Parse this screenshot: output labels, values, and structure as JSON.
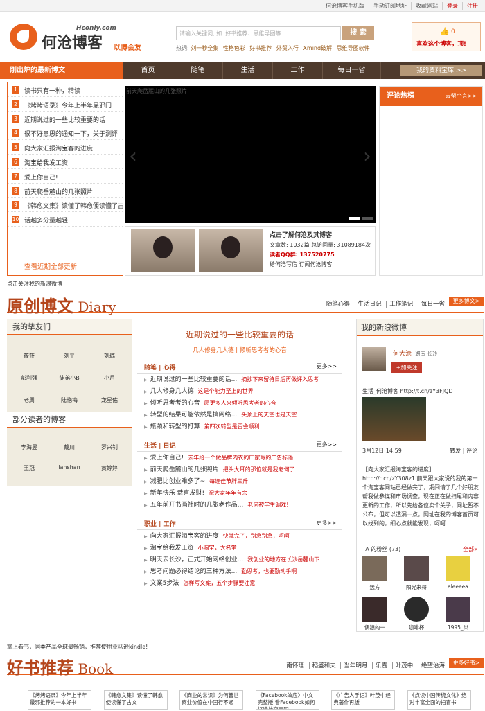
{
  "topbar": {
    "links": [
      "何沧博客手机版",
      "手动订阅地址",
      "收藏网站"
    ],
    "login": "登录",
    "register": "注册"
  },
  "logo": {
    "domain": "Hconly.com",
    "name": "何沧博客",
    "tagline": "以博会友"
  },
  "search": {
    "placeholder": "请输入关键词, 如: 好书推荐、思维导图等...",
    "button": "搜 索"
  },
  "hot": {
    "label": "热词:",
    "words": [
      "刘一秒全集",
      "性格色彩",
      "好书推荐",
      "外贸入行",
      "Xmind破解",
      "思维导图软件"
    ]
  },
  "like": {
    "count": "0",
    "text": "喜欢这个博客，顶!"
  },
  "nav": {
    "latest": "刚出炉的最新博文",
    "items": [
      "首页",
      "随笔",
      "生活",
      "工作",
      "每日一省"
    ],
    "library": "我的资料宝库 >>"
  },
  "latest": {
    "items": [
      "读书只有一种，精读",
      "《烤烤语录》今年上半年最邪门",
      "近期说过的一些比较重要的话",
      "很不好意思的通知一下，关于测评",
      "向大家汇报淘宝客的进度",
      "淘宝给我发工资",
      "爱上你自己!",
      "前天爬岳麓山的几张照片",
      "《韩愈文集》读懂了韩愈便读懂了古文",
      "话越多分量越轻"
    ],
    "more": "查看近期全部更新"
  },
  "slider": {
    "caption": "前天爬岳麓山的几张照片"
  },
  "profile": {
    "title": "点击了解何沧及其博客",
    "articles": "文章数: 1032篇",
    "visits": "总访问量: 31089184次",
    "qq": "读者QQ群: 137520775",
    "links": "给何沧写信  订阅何沧博客"
  },
  "hotcomments": {
    "title": "评论热榜",
    "action": "去留个言>>"
  },
  "follow": "点击关注我的新浪微博",
  "diary": {
    "title": "原创博文",
    "en": " Diary",
    "links": [
      "随笔心得",
      "生活日记",
      "工作笔记",
      "每日一省"
    ],
    "more": "更多博文>"
  },
  "friends": {
    "title": "我的挚友们",
    "list": [
      "筱筱",
      "刘平",
      "刘璐",
      "彭利强",
      "徒弟小B",
      "小月",
      "老周",
      "陆艳梅",
      "龙星佑"
    ],
    "readers_title": "部分读者的博客",
    "readers": [
      "李海昱",
      "戴川",
      "罗兴钊",
      "王冠",
      "lanshan",
      "黄婷婷"
    ]
  },
  "feature": {
    "title": "近期说过的一些比较重要的话",
    "sub": "几人修身几人德 | 倾听思考者的心音"
  },
  "blocks": [
    {
      "head": "随笔 | 心得",
      "more": "更多>>",
      "items": [
        {
          "t": "近期说过的一些比较重要的话...",
          "s": "摘抄下来留待日后再做评入思考"
        },
        {
          "t": "几人修身几人德",
          "s": "这是个能力至上的世界"
        },
        {
          "t": "倾听思考者的心音",
          "s": "愿更多人来倾听思考者的心音"
        },
        {
          "t": "转型的结果可能依然是搞网络...",
          "s": "头顶上的天空也是天空"
        },
        {
          "t": "瓶颈和转型的打算",
          "s": "第四次转型是否会顺利"
        }
      ]
    },
    {
      "head": "生活 | 日记",
      "more": "更多>>",
      "items": [
        {
          "t": "爱上你自己!",
          "s": "去年给一个做品牌内衣的厂家写的广告标语"
        },
        {
          "t": "前天爬岳麓山的几张照片",
          "s": "把头大耳的那位就是我老何了"
        },
        {
          "t": "减肥比创业难多了~",
          "s": "每逢佳节胖三斤"
        },
        {
          "t": "新年快乐 恭喜发财!",
          "s": "祝大家年年有余"
        },
        {
          "t": "五年前开书画社时的几张老作品...",
          "s": "老何被学生调戏!"
        }
      ]
    },
    {
      "head": "职业 | 工作",
      "more": "更多>>",
      "items": [
        {
          "t": "向大家汇报淘宝客的进度",
          "s": "快就完了，别急别急，呵呵"
        },
        {
          "t": "淘宝给我发工资",
          "s": "小淘宝，大名堂"
        },
        {
          "t": "明天去长沙，正式开始网络创业...",
          "s": "我创业的地方在长沙岳麓山下"
        },
        {
          "t": "思考问题必得结论的三种方法...",
          "s": "勤思考，也要勤动手啊"
        },
        {
          "t": "文案5步法",
          "s": "怎样写文案，五个步骤要注意"
        }
      ]
    }
  ],
  "weibo": {
    "title": "我的新浪微博",
    "name": "何大沧",
    "loc": "湖南 长沙",
    "add": "+加关注",
    "link": "生活_何沧博客 http://t.cn/zY3FJQD",
    "date": "3月12日 14:59",
    "ops": "转发 | 评论",
    "post": "【向大家汇报淘宝客的进度】http://t.cn/zY308z1 前天跟大家说的我的第一个淘宝客网站已经做完了，期间请了几个好朋友帮我做参谋和市场调查，现在正在做扫尾和内容更新的工作，所以先给各位卖个关子，网址暂不公布，但可以透漏一点，网址在我的博客首页可以找到的，细心点就能发现，呵呵",
    "fans": "TA 的粉丝 (73)",
    "all": "全部»",
    "fanlist": [
      "远方",
      "阳光来得",
      "aleeeea",
      "偶狼的一",
      "咖啡杯",
      "1995_炎"
    ]
  },
  "amazon": "掌上看书，同类产品全球最畅销，推荐使用亚马逊kindle!",
  "books_sec": {
    "title": "好书推荐",
    "en": " Book",
    "links": [
      "南怀瑾",
      "稻盛和夫",
      "当年明月",
      "乐嘉",
      "叶茂中",
      "绝望治海"
    ],
    "more": "更多好书>"
  },
  "books": [
    "《烤烤语录》今年上半年最邪推荐的一本好书",
    "《韩愈文集》读懂了韩愈便读懂了古文",
    "《商业的常识》为何普世商业价值在中国行不通",
    "《Facebook效应》中文完整版 看Facebook如何打造社交帝国",
    "《广告人手记》叶茂中经典著作再版",
    "《点读中国传统文化》绝对丰富全面的扫盲书"
  ]
}
